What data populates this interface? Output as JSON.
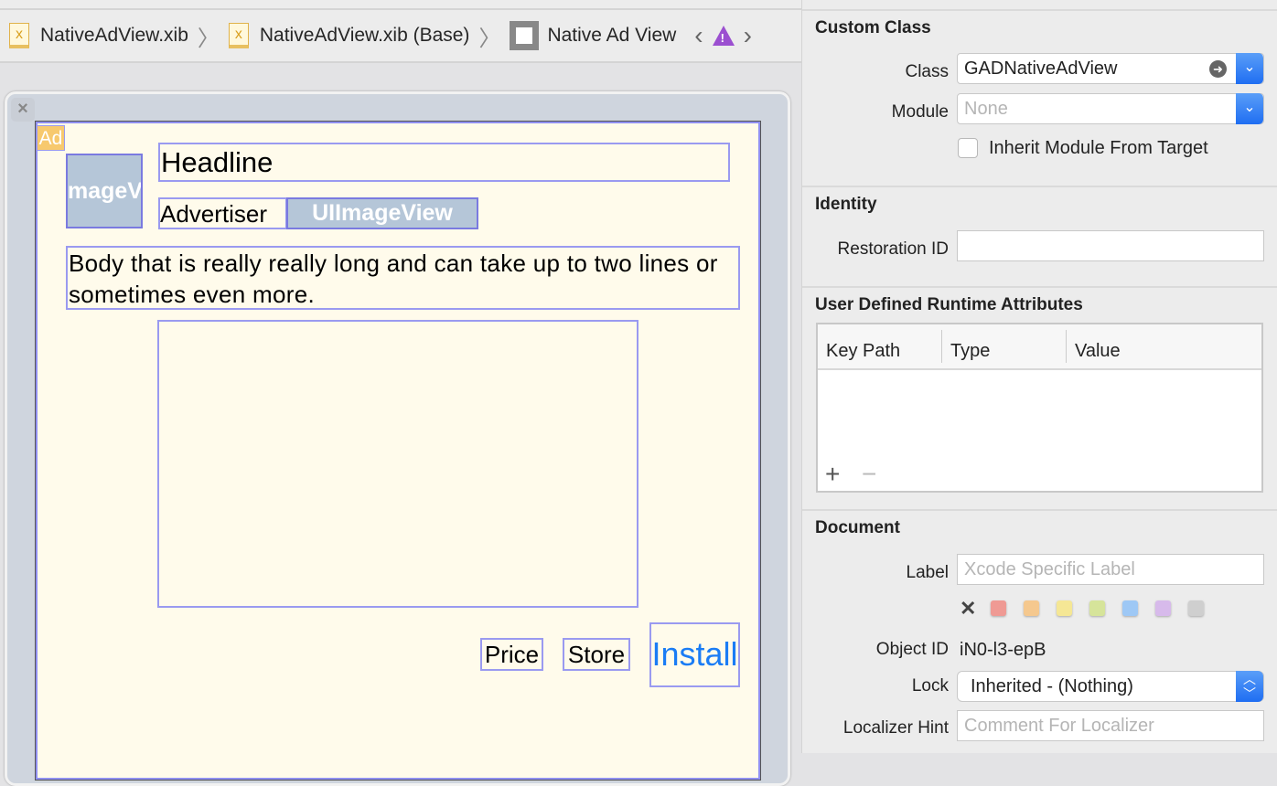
{
  "breadcrumb": {
    "items": [
      "NativeAdView.xib",
      "NativeAdView.xib (Base)",
      "Native Ad View"
    ],
    "file_icon": "xib-file-icon",
    "view_icon": "view-icon",
    "warning_icon": "warning-icon"
  },
  "canvas": {
    "ad_badge": "Ad",
    "icon_view": "mageV",
    "headline": "Headline",
    "advertiser": "Advertiser",
    "star_rating": "UIImageView",
    "body": "Body that is really really long and can take up to two lines or sometimes even more.",
    "price": "Price",
    "store": "Store",
    "install": "Install"
  },
  "inspector": {
    "custom_class": {
      "title": "Custom Class",
      "class_label": "Class",
      "class_value": "GADNativeAdView",
      "module_label": "Module",
      "module_placeholder": "None",
      "inherit_label": "Inherit Module From Target",
      "inherit_checked": false
    },
    "identity": {
      "title": "Identity",
      "restoration_label": "Restoration ID",
      "restoration_value": ""
    },
    "runtime": {
      "title": "User Defined Runtime Attributes",
      "columns": [
        "Key Path",
        "Type",
        "Value"
      ],
      "rows": [],
      "add": "+",
      "remove": "−"
    },
    "document": {
      "title": "Document",
      "label_label": "Label",
      "label_placeholder": "Xcode Specific Label",
      "colors": [
        "#ef9a94",
        "#f5c88e",
        "#f5e795",
        "#d6e49a",
        "#9ec8f5",
        "#d7baeb",
        "#cfcfcf"
      ],
      "object_id_label": "Object ID",
      "object_id": "iN0-l3-epB",
      "lock_label": "Lock",
      "lock_value": "Inherited - (Nothing)",
      "localizer_label": "Localizer Hint",
      "localizer_placeholder": "Comment For Localizer"
    }
  }
}
